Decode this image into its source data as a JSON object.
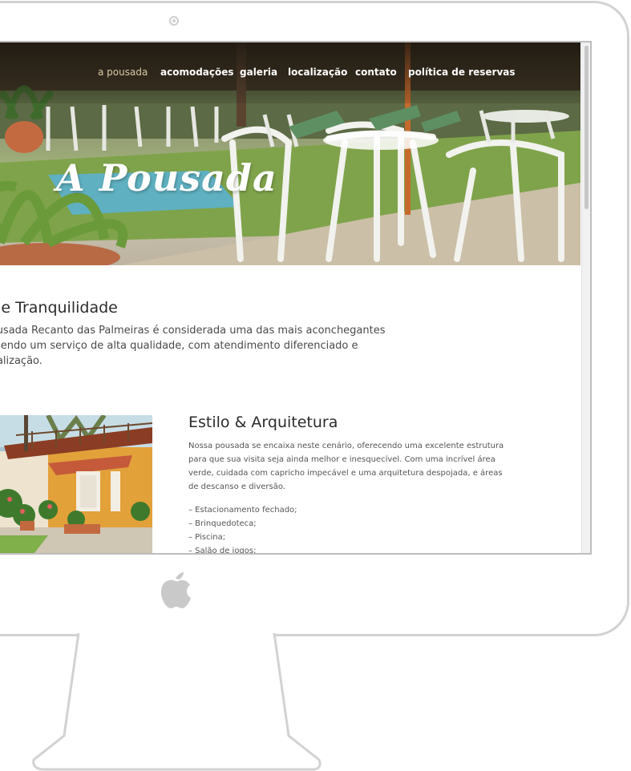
{
  "nav": {
    "items": [
      {
        "label": "a pousada",
        "active": true
      },
      {
        "label": "acomodações",
        "active": false
      },
      {
        "label": "galeria",
        "active": false
      },
      {
        "label": "localização",
        "active": false
      },
      {
        "label": "contato",
        "active": false
      },
      {
        "label": "política de reservas",
        "active": false
      }
    ]
  },
  "hero": {
    "title": "A Pousada"
  },
  "intro": {
    "heading": "ego e Tranquilidade",
    "lines": [
      ", a Pousada Recanto das Palmeiras é considerada uma das mais aconchegantes",
      "oferecendo um serviço de alta qualidade, com atendimento diferenciado e",
      "te localização."
    ]
  },
  "feature": {
    "title": "Estilo & Arquitetura",
    "text_lines": [
      "Nossa pousada se encaixa neste cenário, oferecendo uma excelente estrutura",
      "para que sua visita seja ainda melhor e inesquecível. Com uma incrível área",
      "verde, cuidada com capricho impecável e uma arquitetura despojada, e áreas",
      "de descanso e diversão."
    ],
    "list": [
      "– Estacionamento fechado;",
      "– Brinquedoteca;",
      "– Piscina;",
      "– Salão de jogos;"
    ]
  },
  "icons": {
    "brand_logo": "apple-logo-icon",
    "camera": "camera-icon"
  },
  "colors": {
    "frame": "#d2d2d2",
    "nav_text": "#ffffff",
    "nav_active": "#d9c9a6",
    "heading": "#2b2b2b",
    "body_text": "#555555"
  }
}
